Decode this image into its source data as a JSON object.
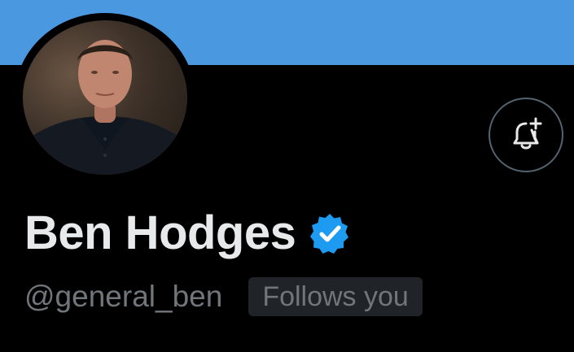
{
  "profile": {
    "display_name": "Ben Hodges",
    "handle": "@general_ben",
    "follows_you_label": "Follows you",
    "verified_icon": "verified-badge-icon",
    "avatar_alt": "profile photo"
  },
  "actions": {
    "notify_icon": "bell-plus-icon"
  },
  "colors": {
    "banner": "#4a98e0",
    "background": "#000000",
    "name_text": "#e7e9ea",
    "secondary_text": "#71767b",
    "verified_badge": "#1d9bf0",
    "badge_bg": "#202327",
    "button_border": "#536471"
  }
}
